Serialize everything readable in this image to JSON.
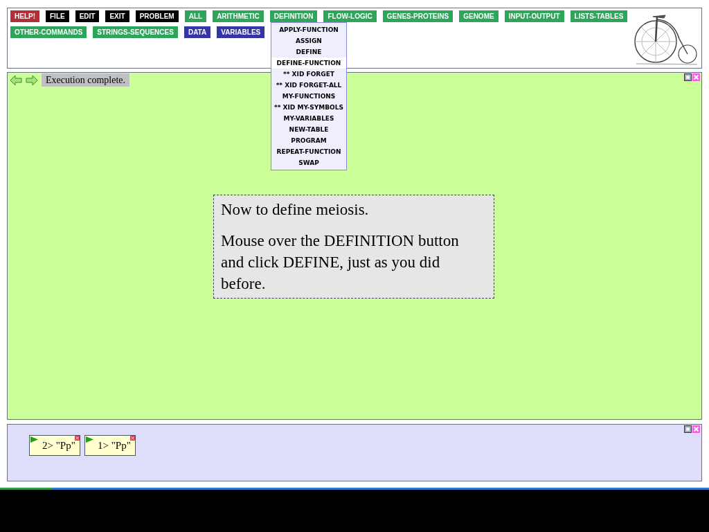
{
  "toolbar": {
    "buttons": [
      {
        "label": "HELP!",
        "color": "#b0303a"
      },
      {
        "label": "FILE",
        "color": "#000000"
      },
      {
        "label": "EDIT",
        "color": "#000000"
      },
      {
        "label": "EXIT",
        "color": "#000000"
      },
      {
        "label": "PROBLEM",
        "color": "#000000"
      },
      {
        "label": "ALL",
        "color": "#2ea55a"
      },
      {
        "label": "ARITHMETIC",
        "color": "#2ea55a"
      },
      {
        "label": "DEFINITION",
        "color": "#2ea55a"
      },
      {
        "label": "FLOW-LOGIC",
        "color": "#2ea55a"
      },
      {
        "label": "GENES-PROTEINS",
        "color": "#2ea55a"
      },
      {
        "label": "GENOME",
        "color": "#2ea55a"
      },
      {
        "label": "INPUT-OUTPUT",
        "color": "#2ea55a"
      },
      {
        "label": "LISTS-TABLES",
        "color": "#2ea55a"
      },
      {
        "label": "OTHER-COMMANDS",
        "color": "#2ea55a"
      },
      {
        "label": "STRINGS-SEQUENCES",
        "color": "#2ea55a"
      },
      {
        "label": "DATA",
        "color": "#3535a6"
      },
      {
        "label": "VARIABLES",
        "color": "#3535a6"
      }
    ]
  },
  "dropdown_menu": {
    "items": [
      {
        "label": "APPLY-FUNCTION",
        "selected": false
      },
      {
        "label": "ASSIGN",
        "selected": false
      },
      {
        "label": "DEFINE",
        "selected": false
      },
      {
        "label": "DEFINE-FUNCTION",
        "selected": true
      },
      {
        "label": "** XID FORGET",
        "selected": false
      },
      {
        "label": "** XID FORGET-ALL",
        "selected": false
      },
      {
        "label": "MY-FUNCTIONS",
        "selected": false
      },
      {
        "label": "** XID MY-SYMBOLS",
        "selected": false
      },
      {
        "label": "MY-VARIABLES",
        "selected": false
      },
      {
        "label": "NEW-TABLE",
        "selected": false
      },
      {
        "label": "PROGRAM",
        "selected": false
      },
      {
        "label": "REPEAT-FUNCTION",
        "selected": false
      },
      {
        "label": "SWAP",
        "selected": false
      }
    ]
  },
  "workspace": {
    "status": "Execution complete.",
    "tutorial_box": {
      "paragraphs": [
        "Now to define meiosis.",
        "Mouse over the DEFINITION button and click DEFINE, just as you did before."
      ]
    }
  },
  "history": {
    "items": [
      {
        "label": "2> \"Pp\""
      },
      {
        "label": "1> \"Pp\""
      }
    ]
  }
}
